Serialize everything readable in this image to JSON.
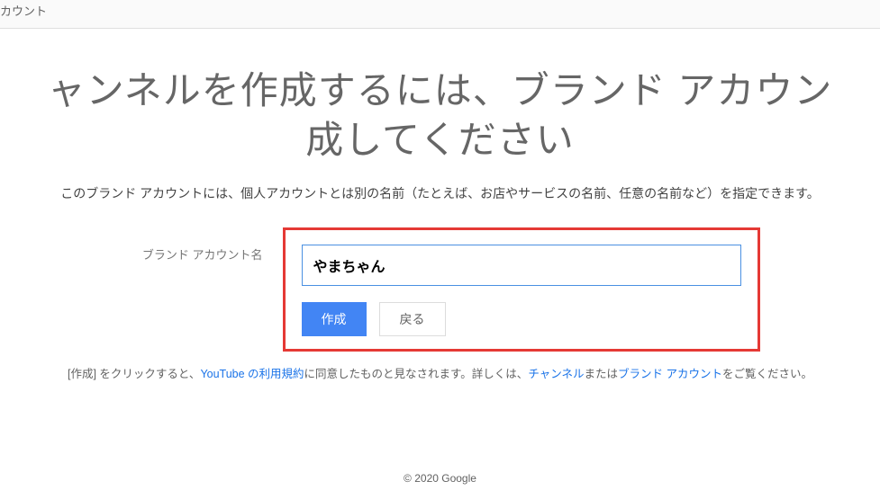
{
  "topbar": {
    "label": "カウント"
  },
  "title": {
    "line1": "ャンネルを作成するには、ブランド アカウン",
    "line2": "成してください"
  },
  "description": "このブランド アカウントには、個人アカウントとは別の名前（たとえば、お店やサービスの名前、任意の名前など）を指定できます。",
  "form": {
    "label": "ブランド アカウント名",
    "value": "やまちゃん",
    "create_label": "作成",
    "back_label": "戻る"
  },
  "terms": {
    "t1": "[作成] をクリックすると、",
    "link1": "YouTube の利用規約",
    "t2": "に同意したものと見なされます。詳しくは、",
    "link2": "チャンネル",
    "t3": "または",
    "link3": "ブランド アカウント",
    "t4": "をご覧ください。"
  },
  "footer": "© 2020 Google"
}
